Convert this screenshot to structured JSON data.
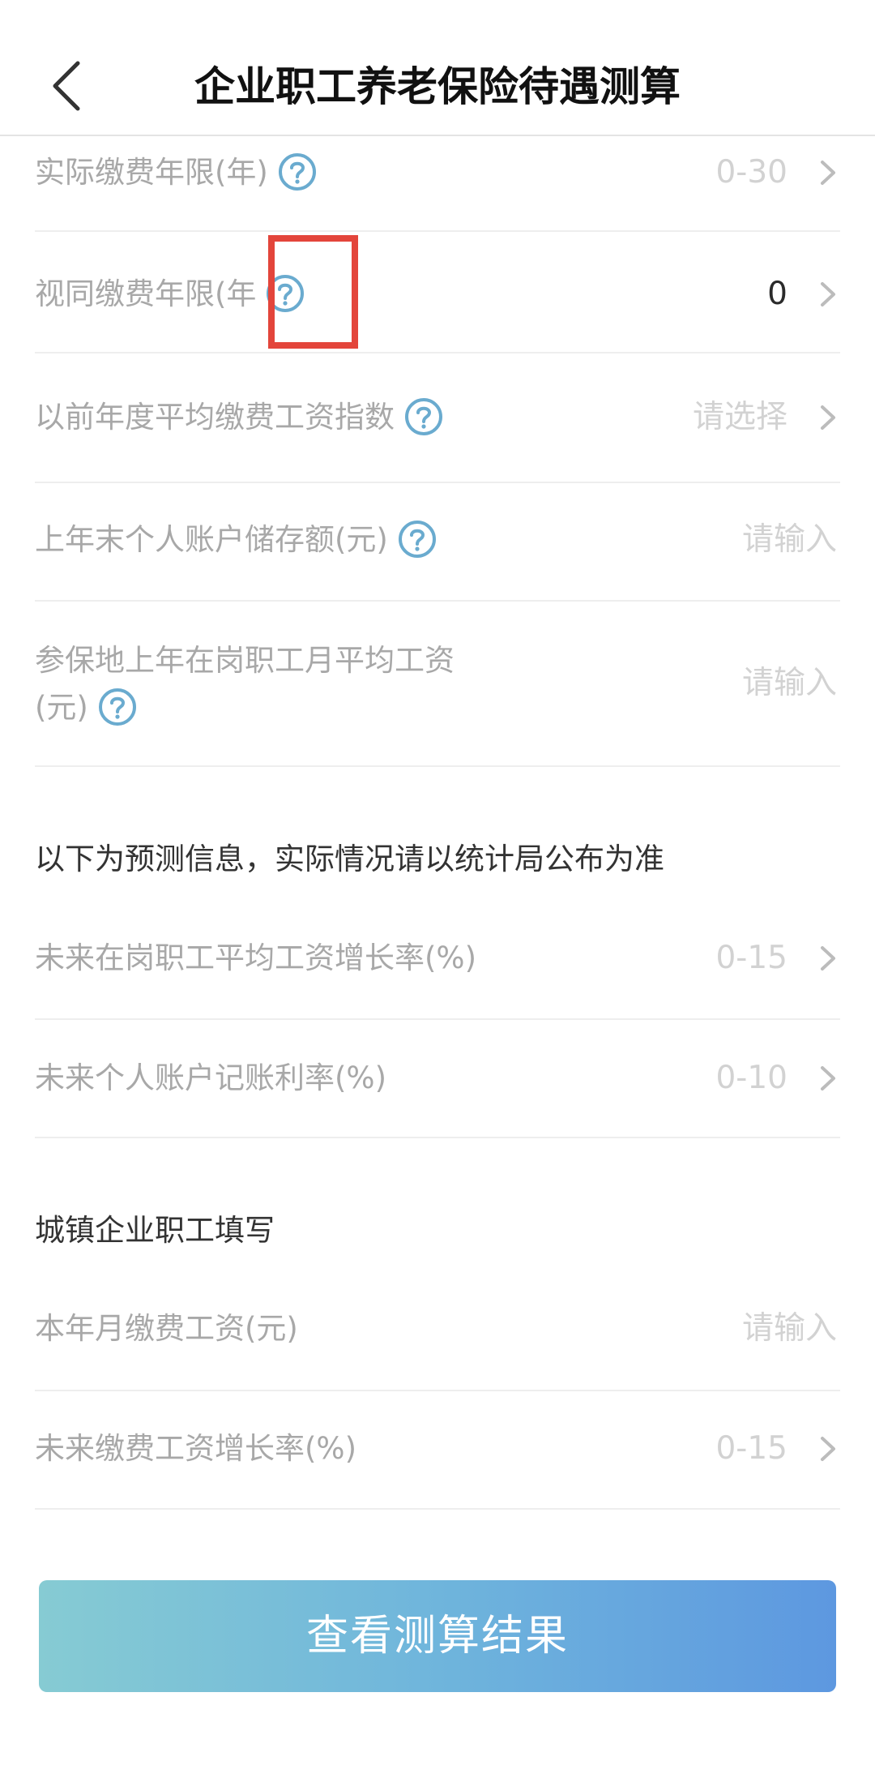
{
  "header": {
    "title": "企业职工养老保险待遇测算"
  },
  "rows": [
    {
      "label": "实际缴费年限(年)",
      "value": "0-30"
    },
    {
      "label": "视同缴费年限(年",
      "value": "0"
    },
    {
      "label": "以前年度平均缴费工资指数",
      "value": "请选择"
    },
    {
      "label": "上年末个人账户储存额(元)",
      "value": "请输入"
    },
    {
      "label_line1": "参保地上年在岗职工月平均工资",
      "label_line2": "(元)",
      "value": "请输入"
    }
  ],
  "forecast": {
    "title": "以下为预测信息，实际情况请以统计局公布为准",
    "rows": [
      {
        "label": "未来在岗职工平均工资增长率(%)",
        "value": "0-15"
      },
      {
        "label": "未来个人账户记账利率(%)",
        "value": "0-10"
      }
    ]
  },
  "urban": {
    "title": "城镇企业职工填写",
    "rows": [
      {
        "label": "本年月缴费工资(元)",
        "value": "请输入"
      },
      {
        "label": "未来缴费工资增长率(%)",
        "value": "0-15"
      }
    ]
  },
  "submit_label": "查看测算结果",
  "icons": {
    "back": "chevron-left-icon",
    "help": "question-circle-icon",
    "arrow": "chevron-right-icon"
  },
  "colors": {
    "help_icon": "#6aabcf",
    "highlight_box": "#e3453b",
    "button_gradient_start": "#86cbd3",
    "button_gradient_end": "#5d98e0"
  }
}
